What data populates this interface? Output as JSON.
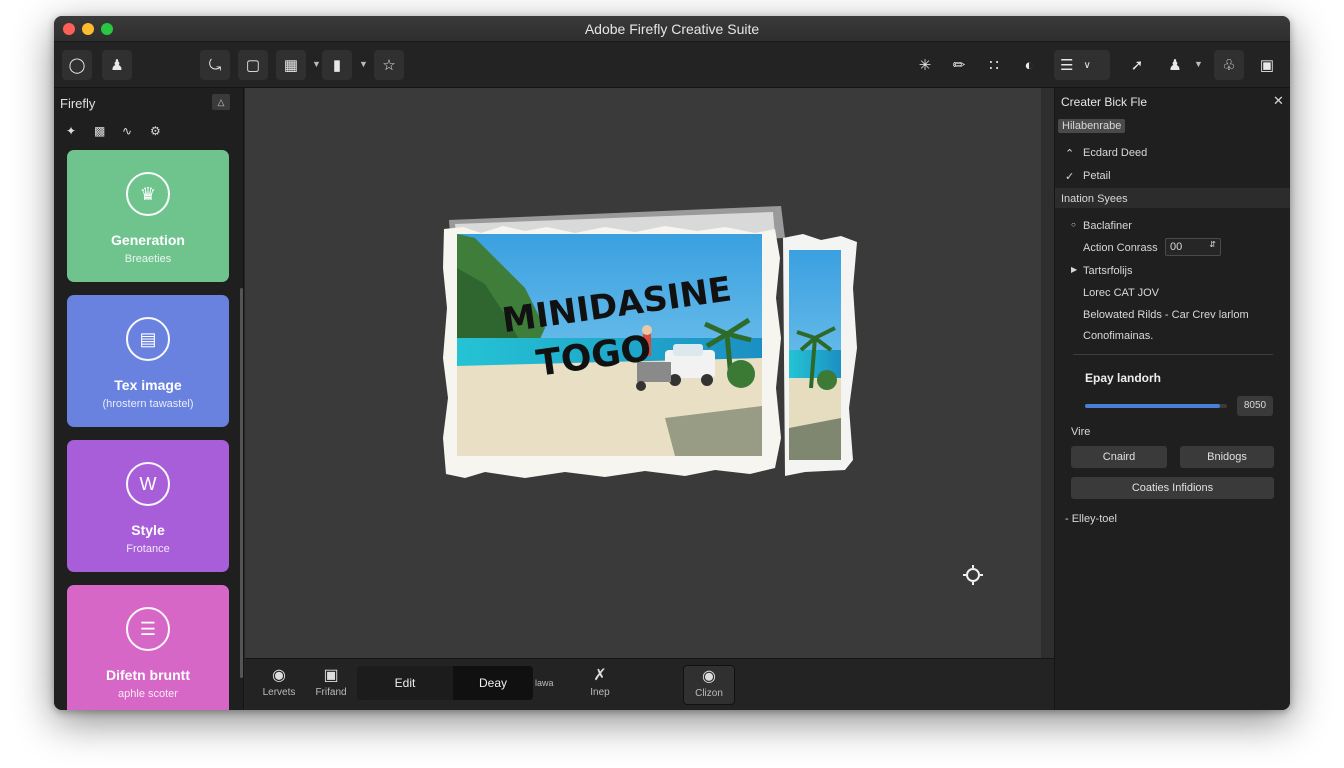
{
  "window": {
    "title": "Adobe Firefly  Creative Suite"
  },
  "toolbar": {
    "icons": [
      "home-icon",
      "user-icon",
      "lasso-icon",
      "crop-icon",
      "grid-icon",
      "folder-icon",
      "star-icon",
      "sparkle-icon",
      "pen-icon",
      "apps-icon",
      "info-icon",
      "list-icon",
      "arrow-icon",
      "person-icon",
      "chat-icon",
      "settings-icon"
    ]
  },
  "sidebar": {
    "header": "Firefly",
    "collapse_label": "△",
    "cards": [
      {
        "title": "Generation",
        "subtitle": "Breaeties",
        "color": "#6fc48e"
      },
      {
        "title": "Tex image",
        "subtitle": "(hrostern tawastel)",
        "color": "#6a82df"
      },
      {
        "title": "Style",
        "subtitle": "Frotance",
        "color": "#a95ed9"
      },
      {
        "title": "Difetn bruntt",
        "subtitle": "aphle scoter",
        "color": "#d767c6"
      }
    ]
  },
  "canvas": {
    "photo_text_line1": "MINIDASINE",
    "photo_text_line2": "TOGO"
  },
  "bottombar": {
    "tool1_label": "Lervets",
    "tool2_label": "Frifand",
    "edit_label": "Edit",
    "deay_label": "Deay",
    "extra_label": "lawa",
    "tool3_label": "Inep",
    "tool4_label": "Clizon"
  },
  "right_panel": {
    "title": "Creater Bick Fle",
    "tag": "Hilabenrabe",
    "row1": "Ecdard Deed",
    "row2": "Petail",
    "section2": "Ination Syees",
    "row3": "Baclafiner",
    "row4_label": "Action Conrass",
    "row4_value": "00",
    "row5": "Tartsrfolijs",
    "row6": "Lorec CAT JOV",
    "row7": "Belowated Rilds - Car Crev larlom",
    "row8": "Conofimainas.",
    "slider_label": "Epay landorh",
    "slider_value": "8050",
    "slider_level": 0.95,
    "vire_label": "Vire",
    "btn1": "Cnaird",
    "btn2": "Bnidogs",
    "btn3": "Coaties Infidions",
    "footer": "- Elley-toel"
  }
}
